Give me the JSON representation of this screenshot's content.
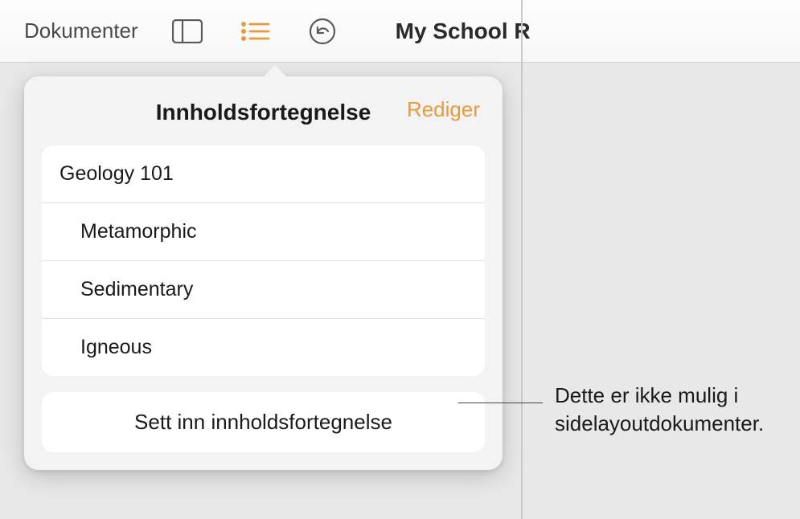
{
  "toolbar": {
    "back_label": "Dokumenter",
    "doc_title": "My School R"
  },
  "popover": {
    "title": "Innholdsfortegnelse",
    "edit_label": "Rediger",
    "items": [
      {
        "label": "Geology 101",
        "indent": false
      },
      {
        "label": "Metamorphic",
        "indent": true
      },
      {
        "label": "Sedimentary",
        "indent": true
      },
      {
        "label": "Igneous",
        "indent": true
      }
    ],
    "insert_label": "Sett inn innholdsfortegnelse"
  },
  "callout": {
    "text_line1": "Dette er ikke mulig i",
    "text_line2": "sidelayoutdokumenter."
  }
}
